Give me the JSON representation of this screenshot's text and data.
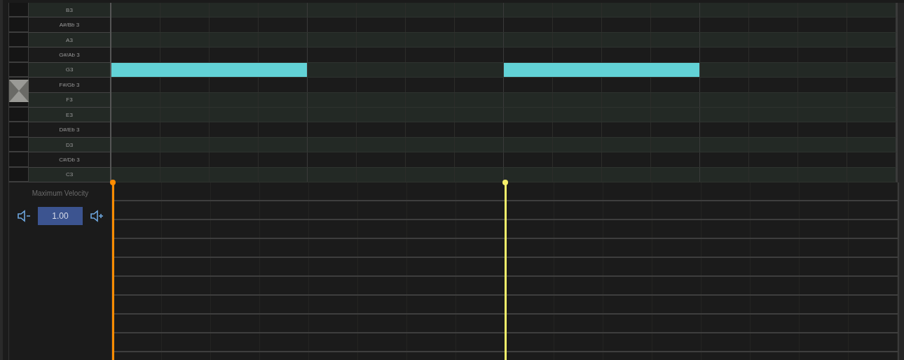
{
  "keys": [
    {
      "label": "B3",
      "kind": "natural",
      "bars": [
        false,
        false,
        false,
        false
      ]
    },
    {
      "label": "A#/Bb 3",
      "kind": "sharp",
      "bars": [
        false,
        false,
        false,
        false
      ]
    },
    {
      "label": "A3",
      "kind": "natural",
      "bars": [
        false,
        false,
        false,
        false
      ]
    },
    {
      "label": "G#/Ab 3",
      "kind": "sharp",
      "bars": [
        false,
        false,
        false,
        false
      ]
    },
    {
      "label": "G3",
      "kind": "natural",
      "bars": [
        true,
        false,
        true,
        false
      ]
    },
    {
      "label": "F#/Gb 3",
      "kind": "sharp",
      "bars": [
        false,
        false,
        false,
        false
      ]
    },
    {
      "label": "F3",
      "kind": "natural",
      "bars": [
        false,
        false,
        false,
        false
      ]
    },
    {
      "label": "E3",
      "kind": "natural",
      "bars": [
        false,
        false,
        false,
        false
      ]
    },
    {
      "label": "D#/Eb 3",
      "kind": "sharp",
      "bars": [
        false,
        false,
        false,
        false
      ]
    },
    {
      "label": "D3",
      "kind": "natural",
      "bars": [
        false,
        false,
        false,
        false
      ]
    },
    {
      "label": "C#/Db 3",
      "kind": "sharp",
      "bars": [
        false,
        false,
        false,
        false
      ]
    },
    {
      "label": "C3",
      "kind": "natural",
      "bars": [
        false,
        false,
        false,
        false
      ]
    }
  ],
  "velocity_panel": {
    "label": "Maximum Velocity",
    "value": "1.00"
  },
  "velocities": [
    {
      "color": "#ff8c00",
      "level": 1
    },
    {
      "color": "#f5f06a",
      "level": 1
    }
  ]
}
